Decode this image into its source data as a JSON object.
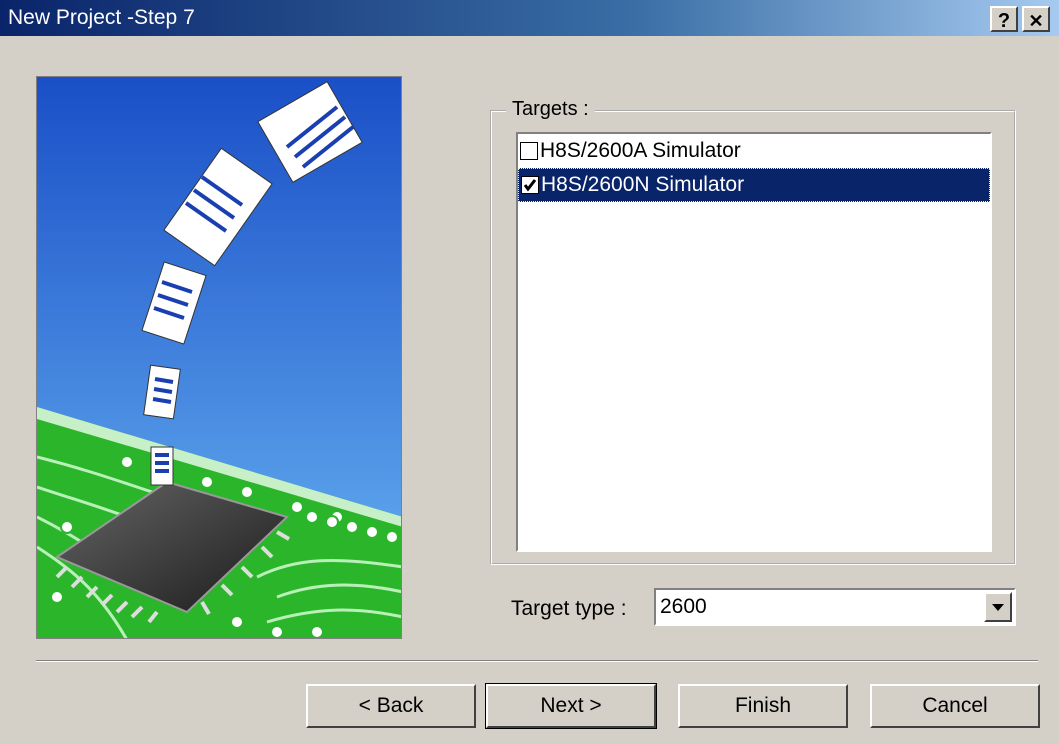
{
  "window": {
    "title": "New Project -Step 7",
    "help_label": "?",
    "close_label": "✕"
  },
  "targets": {
    "legend": "Targets :",
    "items": [
      {
        "label": "H8S/2600A Simulator",
        "checked": false,
        "selected": false
      },
      {
        "label": "H8S/2600N Simulator",
        "checked": true,
        "selected": true
      }
    ]
  },
  "target_type": {
    "label": "Target type :",
    "value": "2600"
  },
  "buttons": {
    "back": "< Back",
    "next": "Next >",
    "finish": "Finish",
    "cancel": "Cancel"
  },
  "colors": {
    "selection": "#0a246a",
    "dialog_bg": "#d4d0c8",
    "board_green": "#2bb52b",
    "sky_blue": "#2f6fd8"
  }
}
